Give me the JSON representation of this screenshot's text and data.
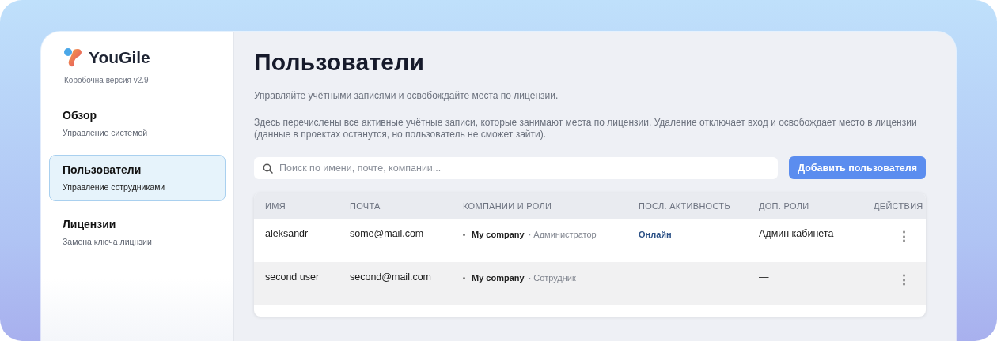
{
  "sidebar": {
    "logo": "YouGile",
    "version": "Коробочна версия v2.9",
    "items": [
      {
        "title": "Обзор",
        "subtitle": "Управление системой",
        "selected": false
      },
      {
        "title": "Пользователи",
        "subtitle": "Управление сотрудниками",
        "selected": true
      },
      {
        "title": "Лицензии",
        "subtitle": "Замена ключа лицнзии",
        "selected": false
      }
    ]
  },
  "page": {
    "title": "Пользователи",
    "subtitle": "Управляйте учётными записями и освобождайте места по лицензии.",
    "description": "Здесь перечислены все активные учётные записи, которые занимают места по лицензии. Удаление отключает вход и освобождает место в лицензии (данные в проектах останутся, но пользователь не сможет зайти).",
    "search": {
      "placeholder": "Поиск по имени, почте, компании..."
    },
    "add_button": "Добавить пользователя"
  },
  "table": {
    "columns": [
      "ИМЯ",
      "ПОЧТА",
      "КОМПАНИИ И РОЛИ",
      "ПОСЛ. АКТИВНОСТЬ",
      "ДОП. РОЛИ",
      "ДЕЙСТВИЯ"
    ],
    "rows": [
      {
        "name": "aleksandr",
        "email": "some@mail.com",
        "company": "My company",
        "role": "· Администратор",
        "activity": "Онлайн",
        "online": true,
        "extra_role": "Админ кабинета",
        "actions": "⋮"
      },
      {
        "name": "second user",
        "email": "second@mail.com",
        "company": "My company",
        "role": "· Сотрудник",
        "activity": "—",
        "online": false,
        "extra_role": "—",
        "actions": "⋮"
      }
    ]
  }
}
